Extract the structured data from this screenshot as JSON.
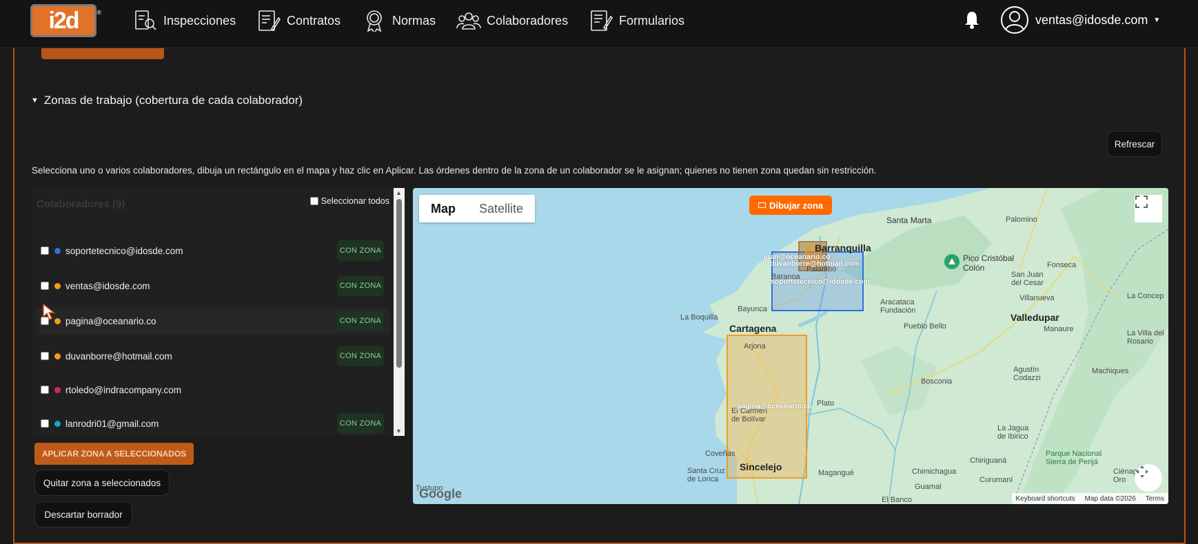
{
  "navbar": {
    "logo": "i2d",
    "items": [
      {
        "label": "Inspecciones",
        "icon": "inspection-icon"
      },
      {
        "label": "Contratos",
        "icon": "contract-icon"
      },
      {
        "label": "Normas",
        "icon": "award-icon"
      },
      {
        "label": "Colaboradores",
        "icon": "users-icon"
      },
      {
        "label": "Formularios",
        "icon": "form-icon"
      }
    ],
    "user_email": "ventas@idosde.com"
  },
  "section": {
    "title": "Zonas de trabajo (cobertura de cada colaborador)",
    "refresh_label": "Refrescar",
    "description": "Selecciona uno o varios colaboradores, dibuja un rectángulo en el mapa y haz clic en Aplicar. Las órdenes dentro de la zona de un colaborador se le asignan; quienes no tienen zona quedan sin restricción."
  },
  "collaborators": {
    "heading": "Colaboradores (9)",
    "select_all_label": "Seleccionar todos",
    "badge_label": "CON ZONA",
    "rows": [
      {
        "email": "soportetecnico@idosde.com",
        "color": "#2b6fe0",
        "has_zone": true
      },
      {
        "email": "ventas@idosde.com",
        "color": "#f59a1b",
        "has_zone": true
      },
      {
        "email": "pagina@oceanario.co",
        "color": "#f59a1b",
        "has_zone": true
      },
      {
        "email": "duvanborre@hotmail.com",
        "color": "#f59a1b",
        "has_zone": true
      },
      {
        "email": "rtoledo@indracompany.com",
        "color": "#d0246a",
        "has_zone": false
      },
      {
        "email": "lanrodri01@gmail.com",
        "color": "#12a8c0",
        "has_zone": true
      }
    ]
  },
  "actions": {
    "apply": "APLICAR ZONA A SELECCIONADOS",
    "remove": "Quitar zona a seleccionados",
    "discard": "Descartar borrador"
  },
  "map": {
    "tab_map": "Map",
    "tab_satellite": "Satellite",
    "draw_label": "Dibujar zona",
    "zone_labels": {
      "blue": "soportetecnico@idosde.com",
      "small_a": "juan@oceanario.co",
      "small_b": "duvanborre@hotmail.com",
      "orange": "pagina@oceanario.co"
    },
    "places": {
      "barranquilla": "Barranquilla",
      "santa_marta": "Santa Marta",
      "palomino": "Palomino",
      "pico": "Pico Cristóbal Colón",
      "cartagena": "Cartagena",
      "valledupar": "Valledupar",
      "sincelejo": "Sincelejo",
      "arjona": "Arjona",
      "el_carmen": "El Carmen de Bolívar",
      "la_boquilla": "La Boquilla",
      "bayunca": "Bayunca",
      "baranoa": "Baranoa",
      "palambo": "Palambo",
      "aracataca": "Aracataca Fundación",
      "pueblo_bello": "Pueblo Bello",
      "fonseca": "Fonseca",
      "san_juan": "San Juan del Cesar",
      "villanueva": "Villanueva",
      "la_concep": "La Concep",
      "manaure": "Manaure",
      "la_villa": "La Villa del Rosario",
      "bosconia": "Bosconia",
      "plato": "Plato",
      "agustin": "Agustín Codazzi",
      "machiques": "Machiques",
      "covenas": "Coveñas",
      "santa_cruz": "Santa Cruz de Lorica",
      "magangue": "Magangué",
      "chimichagua": "Chimichagua",
      "chiriguana": "Chiriguaná",
      "la_jagua": "La Jagua de Ibirico",
      "guamal": "Guamal",
      "curumani": "Curumaní",
      "parque": "Parque Nacional Sierra de Perijá",
      "cienaga": "Ciénaga de Oro",
      "tustupo": "Tustupo",
      "el_banco": "El Banco"
    },
    "attribution": {
      "shortcuts": "Keyboard shortcuts",
      "data": "Map data ©2026",
      "terms": "Terms"
    },
    "google": "Google"
  }
}
